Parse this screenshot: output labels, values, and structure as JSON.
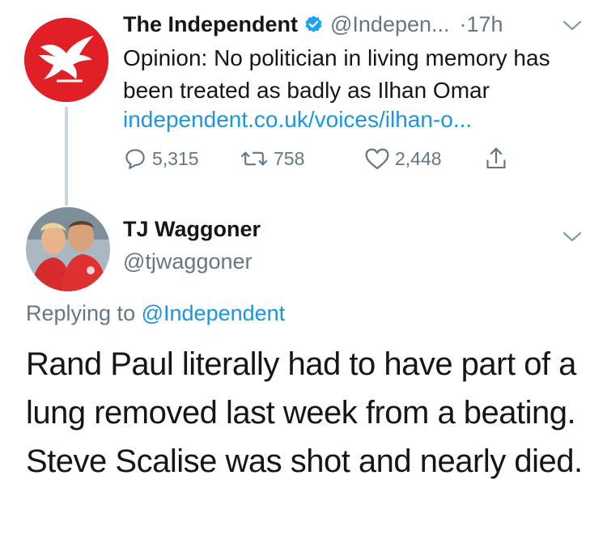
{
  "parent_tweet": {
    "author_name": "The Independent",
    "author_handle": "@Indepen...",
    "time": "·17h",
    "text": "Opinion: No politician in living memory has been treated as badly as Ilhan Omar",
    "link": "independent.co.uk/voices/ilhan-o...",
    "reply_count": "5,315",
    "retweet_count": "758",
    "like_count": "2,448",
    "verified": true
  },
  "reply_tweet": {
    "author_name": "TJ Waggoner",
    "author_handle": "@tjwaggoner",
    "replying_to_prefix": "Replying to",
    "replying_to_mention": "@Independent",
    "text": "Rand Paul literally had to have part of a lung removed last week from a beating. Steve Scalise was shot and nearly died."
  },
  "colors": {
    "brand_red": "#e01f26",
    "link_blue": "#1b95e0",
    "secondary_gray": "#657786",
    "text_dark": "#14171a",
    "thread_line": "#ccd6dd"
  },
  "icons": {
    "avatar_parent": "eagle-logo-icon",
    "verified": "verified-badge-icon",
    "reply": "reply-bubble-icon",
    "retweet": "retweet-icon",
    "like": "heart-icon",
    "share": "share-icon",
    "menu": "chevron-down-icon"
  }
}
